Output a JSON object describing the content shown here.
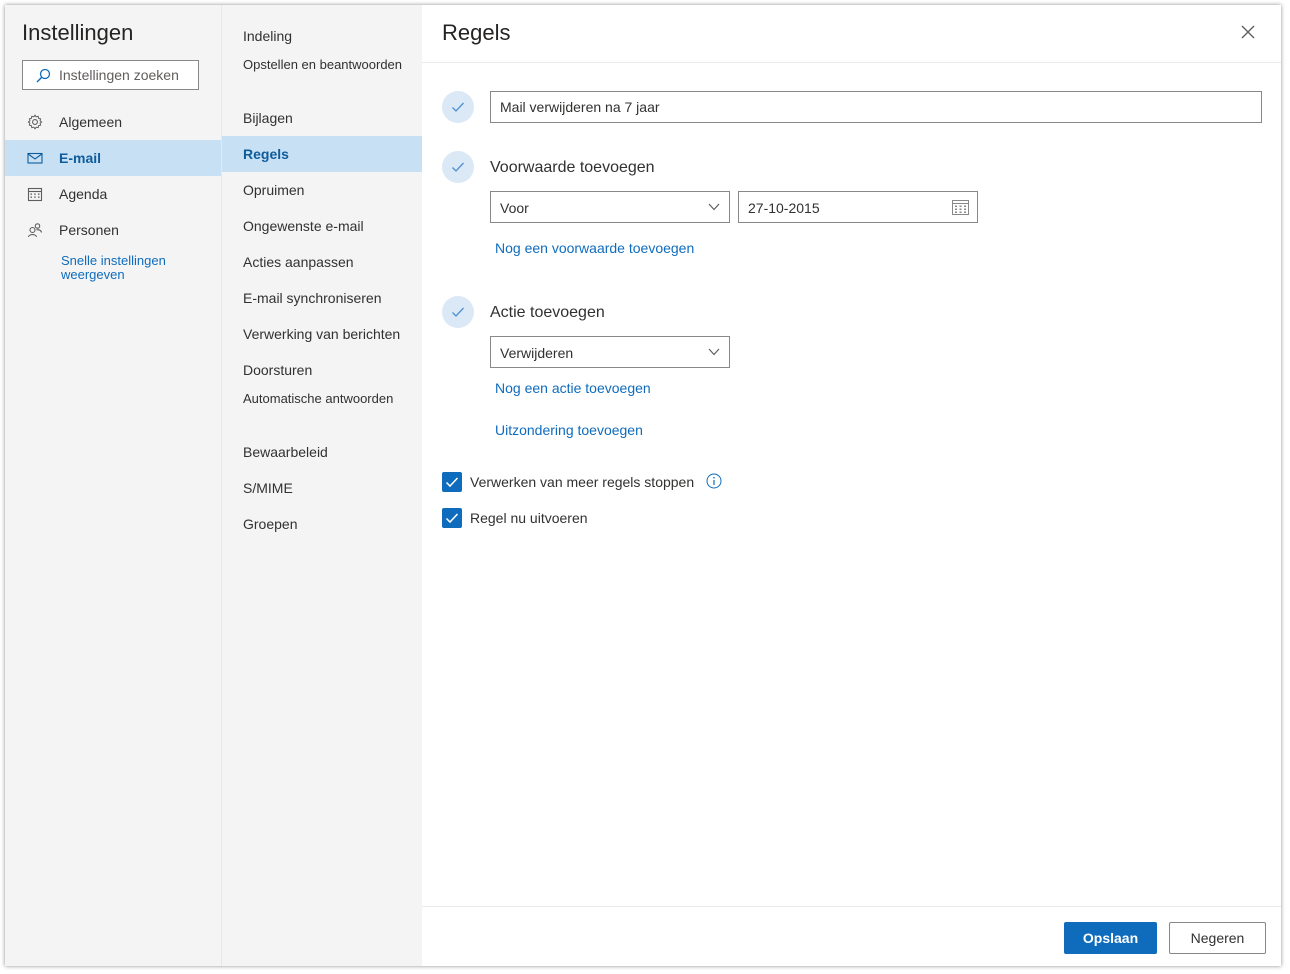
{
  "sidebar": {
    "title": "Instellingen",
    "search_placeholder": "Instellingen zoeken",
    "items": [
      {
        "label": "Algemeen",
        "icon": "gear-icon"
      },
      {
        "label": "E-mail",
        "icon": "mail-icon"
      },
      {
        "label": "Agenda",
        "icon": "calendar-icon"
      },
      {
        "label": "Personen",
        "icon": "people-icon"
      }
    ],
    "quick_settings_link": "Snelle instellingen weergeven"
  },
  "subnav": {
    "items": [
      {
        "label": "Indeling"
      },
      {
        "label": "Opstellen en beantwoorden"
      },
      {
        "label": "Bijlagen"
      },
      {
        "label": "Regels"
      },
      {
        "label": "Opruimen"
      },
      {
        "label": "Ongewenste e-mail"
      },
      {
        "label": "Acties aanpassen"
      },
      {
        "label": "E-mail synchroniseren"
      },
      {
        "label": "Verwerking van berichten"
      },
      {
        "label": "Doorsturen"
      },
      {
        "label": "Automatische antwoorden"
      },
      {
        "label": "Bewaarbeleid"
      },
      {
        "label": "S/MIME"
      },
      {
        "label": "Groepen"
      }
    ]
  },
  "main": {
    "title": "Regels",
    "rule_name": "Mail verwijderen na 7 jaar",
    "condition": {
      "label": "Voorwaarde toevoegen",
      "select_value": "Voor",
      "date_value": "27-10-2015",
      "add_link": "Nog een voorwaarde toevoegen"
    },
    "action": {
      "label": "Actie toevoegen",
      "select_value": "Verwijderen",
      "add_link": "Nog een actie toevoegen",
      "exception_link": "Uitzondering toevoegen"
    },
    "options": [
      {
        "label": "Verwerken van meer regels stoppen",
        "checked": true
      },
      {
        "label": "Regel nu uitvoeren",
        "checked": true
      }
    ]
  },
  "footer": {
    "save_label": "Opslaan",
    "cancel_label": "Negeren"
  },
  "colors": {
    "accent": "#0f6cbd",
    "selected_bg": "#c7e0f4",
    "sidebar_bg": "#f4f4f4"
  }
}
